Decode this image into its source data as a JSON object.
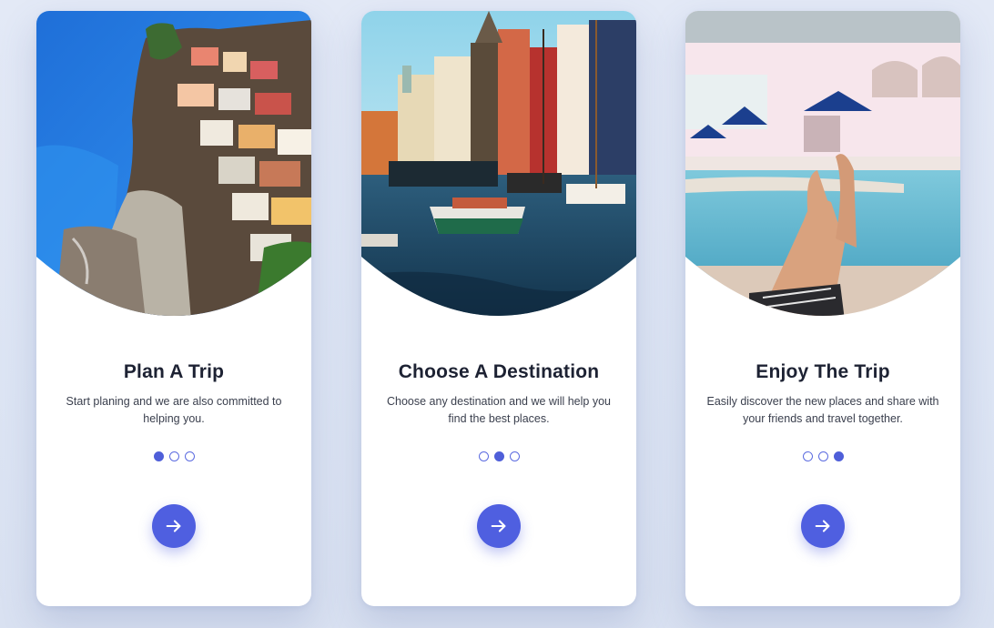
{
  "slides": [
    {
      "title": "Plan A Trip",
      "description": "Start planing and we are also committed to helping you.",
      "active_index": 0,
      "image": "coastal-cliff-village-photo",
      "button_icon": "arrow-right-icon"
    },
    {
      "title": "Choose A Destination",
      "description": "Choose any destination and we will help you find the best places.",
      "active_index": 1,
      "image": "canal-boats-city-photo",
      "button_icon": "arrow-right-icon"
    },
    {
      "title": "Enjoy The Trip",
      "description": "Easily discover the new places and share with your friends and travel together.",
      "active_index": 2,
      "image": "poolside-resort-photo",
      "button_icon": "arrow-right-icon"
    }
  ],
  "colors": {
    "accent": "#4f5fe0",
    "title": "#1d2233",
    "text": "#3a3f4d",
    "background": "#e0e7f5"
  }
}
